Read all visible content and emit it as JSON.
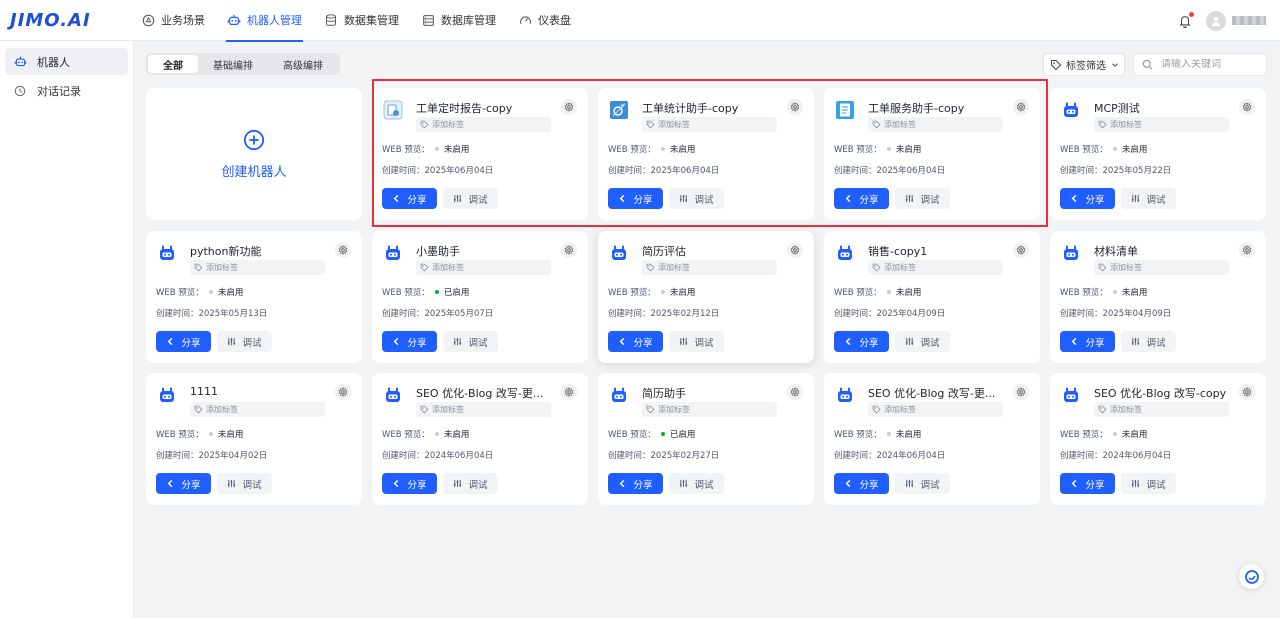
{
  "app": {
    "logo": "JIMO.AI"
  },
  "nav": [
    {
      "label": "业务场景",
      "icon": "scene-icon",
      "active": false
    },
    {
      "label": "机器人管理",
      "icon": "robot-icon",
      "active": true
    },
    {
      "label": "数据集管理",
      "icon": "dataset-icon",
      "active": false
    },
    {
      "label": "数据库管理",
      "icon": "database-icon",
      "active": false
    },
    {
      "label": "仪表盘",
      "icon": "dashboard-icon",
      "active": false
    }
  ],
  "sidebar": [
    {
      "label": "机器人",
      "icon": "robot-icon",
      "active": true
    },
    {
      "label": "对话记录",
      "icon": "history-icon",
      "active": false
    }
  ],
  "tabs": [
    {
      "label": "全部",
      "active": true
    },
    {
      "label": "基础编排",
      "active": false
    },
    {
      "label": "高级编排",
      "active": false
    }
  ],
  "toolbar": {
    "tag_filter_label": "标签筛选",
    "search_placeholder": "请输入关键词"
  },
  "create": {
    "label": "创建机器人"
  },
  "card_labels": {
    "tag": "添加标签",
    "web_prefix": "WEB 预览：",
    "created_prefix": "创建时间：",
    "share": "分享",
    "debug": "调试"
  },
  "accent_color": "#1f5eff",
  "bots": [
    {
      "name": "工单定时报告-copy",
      "status": "未启用",
      "enabled": false,
      "created": "2025年06月04日",
      "icon": "report-icon"
    },
    {
      "name": "工单统计助手-copy",
      "status": "未启用",
      "enabled": false,
      "created": "2025年06月04日",
      "icon": "stats-icon"
    },
    {
      "name": "工单服务助手-copy",
      "status": "未启用",
      "enabled": false,
      "created": "2025年06月04日",
      "icon": "service-icon"
    },
    {
      "name": "MCP测试",
      "status": "未启用",
      "enabled": false,
      "created": "2025年05月22日",
      "icon": "robot-icon"
    },
    {
      "name": "python新功能",
      "status": "未启用",
      "enabled": false,
      "created": "2025年05月13日",
      "icon": "robot-icon"
    },
    {
      "name": "小墨助手",
      "status": "已启用",
      "enabled": true,
      "created": "2025年05月07日",
      "icon": "robot-icon"
    },
    {
      "name": "简历评估",
      "status": "未启用",
      "enabled": false,
      "created": "2025年02月12日",
      "icon": "robot-icon"
    },
    {
      "name": "销售-copy1",
      "status": "未启用",
      "enabled": false,
      "created": "2025年04月09日",
      "icon": "robot-icon"
    },
    {
      "name": "材料清单",
      "status": "未启用",
      "enabled": false,
      "created": "2025年04月09日",
      "icon": "robot-icon"
    },
    {
      "name": "1111",
      "status": "未启用",
      "enabled": false,
      "created": "2025年04月02日",
      "icon": "robot-icon"
    },
    {
      "name": "SEO 优化-Blog 改写-更...",
      "status": "未启用",
      "enabled": false,
      "created": "2024年06月04日",
      "icon": "robot-icon"
    },
    {
      "name": "简历助手",
      "status": "已启用",
      "enabled": true,
      "created": "2025年02月27日",
      "icon": "robot-icon"
    },
    {
      "name": "SEO 优化-Blog 改写-更...",
      "status": "未启用",
      "enabled": false,
      "created": "2024年06月04日",
      "icon": "robot-icon"
    },
    {
      "name": "SEO 优化-Blog 改写-copy",
      "status": "未启用",
      "enabled": false,
      "created": "2024年06月04日",
      "icon": "robot-icon"
    }
  ]
}
